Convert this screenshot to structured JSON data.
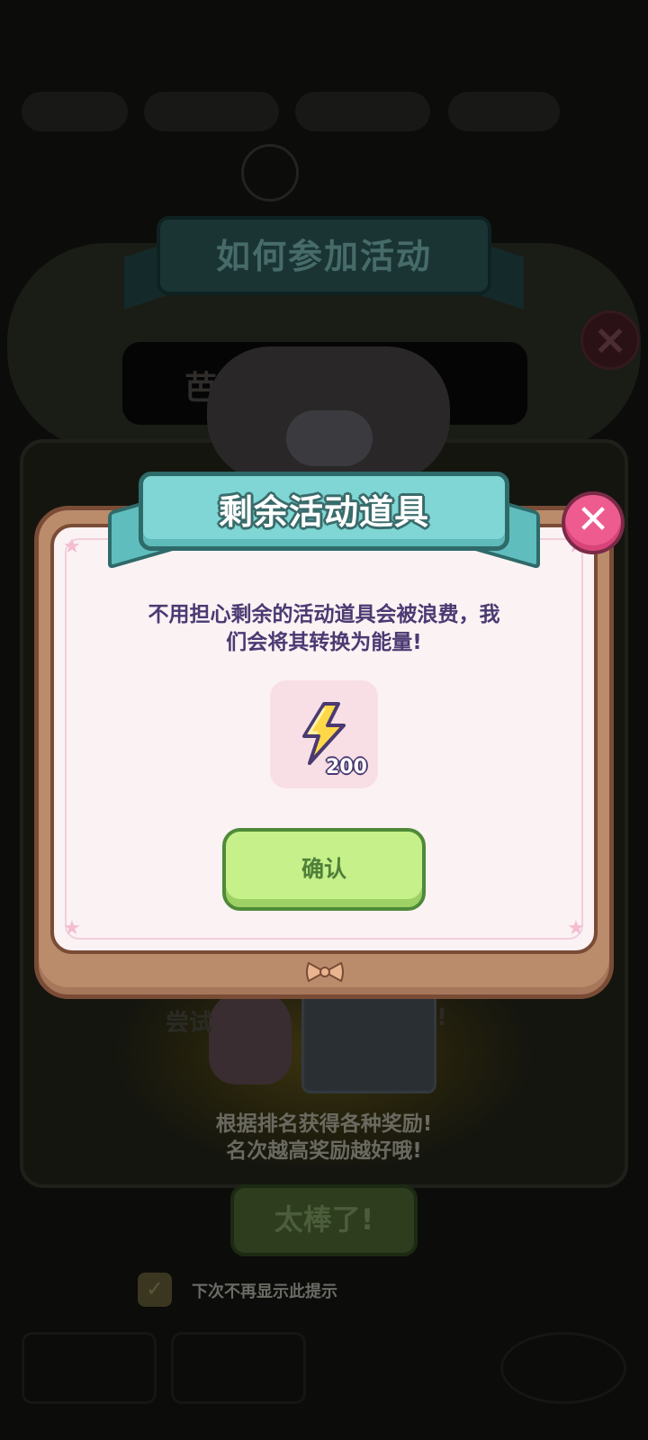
{
  "background": {
    "ribbon_title": "如何参加活动",
    "banner_text": "芭",
    "try_text_left": "尝试",
    "try_text_right": "!",
    "rank_line1": "根据排名获得各种奖励!",
    "rank_line2": "名次越高奖励越好哦!",
    "great_button": "太棒了!",
    "dont_show_again": "下次不再显示此提示",
    "dont_show_checked": true
  },
  "dialog": {
    "title": "剩余活动道具",
    "message_line1": "不用担心剩余的活动道具会被浪费，我",
    "message_line2": "们会将其转换为能量!",
    "reward": {
      "icon": "lightning-bolt-icon",
      "count": "200"
    },
    "confirm_label": "确认",
    "close_icon": "close-x-icon"
  },
  "colors": {
    "frame_brown": "#bb8c6c",
    "panel_pink": "#fbf2f4",
    "ribbon_teal": "#7fd6d5",
    "close_pink": "#ee5c8f",
    "confirm_green": "#c6f08a",
    "text_purple": "#4a3a72"
  }
}
